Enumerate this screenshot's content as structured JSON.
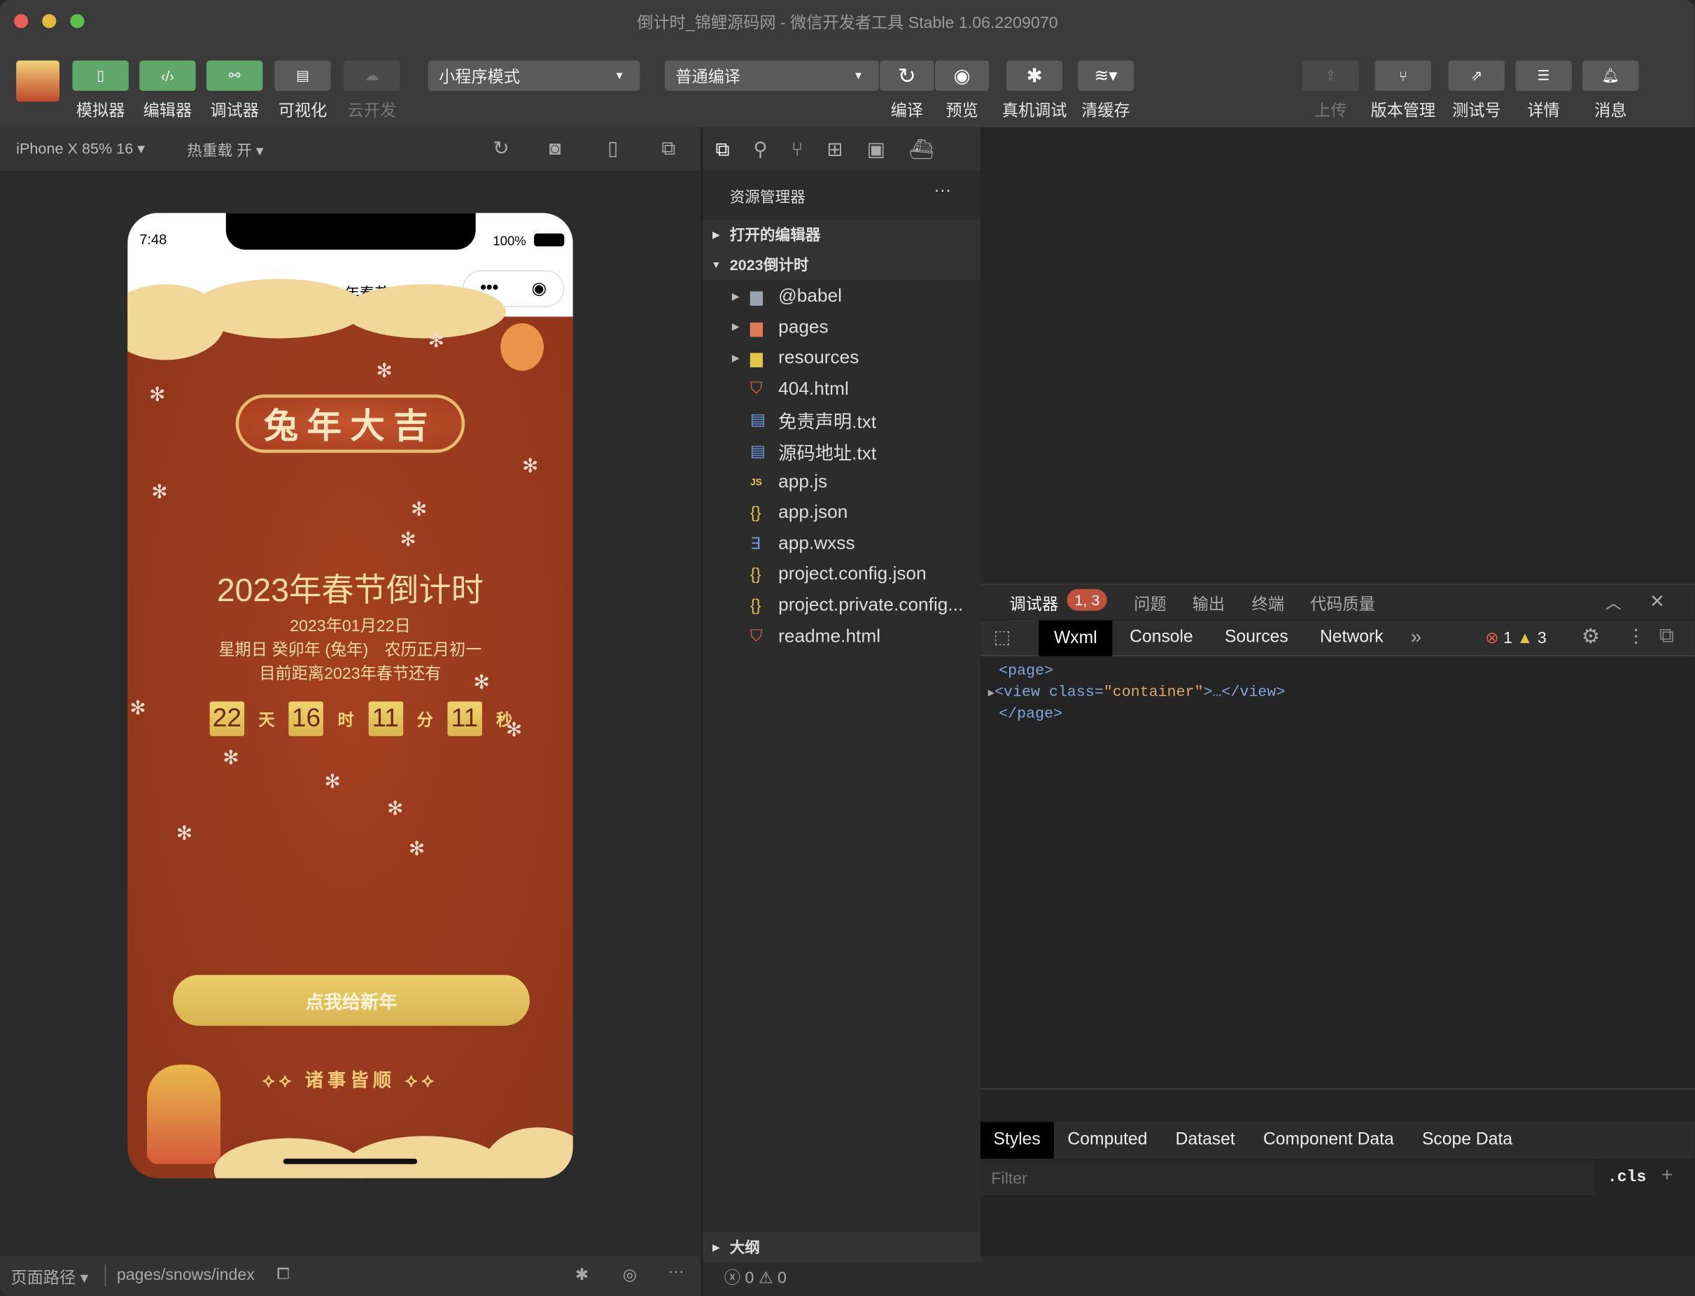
{
  "window": {
    "title": "倒计时_锦鲤源码网 - 微信开发者工具 Stable 1.06.2209070"
  },
  "toolbar": {
    "left": [
      {
        "label": "模拟器",
        "icon": "phone-icon"
      },
      {
        "label": "编辑器",
        "icon": "code-icon"
      },
      {
        "label": "调试器",
        "icon": "debug-icon"
      },
      {
        "label": "可视化",
        "icon": "layout-icon"
      },
      {
        "label": "云开发",
        "icon": "cloud-icon"
      }
    ],
    "mode_select": "小程序模式",
    "compile_select": "普通编译",
    "mid": [
      {
        "label": "编译",
        "icon": "refresh-icon"
      },
      {
        "label": "预览",
        "icon": "eye-icon"
      },
      {
        "label": "真机调试",
        "icon": "bug-icon"
      },
      {
        "label": "清缓存",
        "icon": "layers-icon"
      }
    ],
    "right": [
      {
        "label": "上传",
        "icon": "upload-icon"
      },
      {
        "label": "版本管理",
        "icon": "branch-icon"
      },
      {
        "label": "测试号",
        "icon": "external-icon"
      },
      {
        "label": "详情",
        "icon": "menu-icon"
      },
      {
        "label": "消息",
        "icon": "bell-icon"
      }
    ]
  },
  "simulator": {
    "device": "iPhone X 85% 16",
    "hot_reload": "热重载 开",
    "phone": {
      "time": "7:48",
      "battery": "100%",
      "nav_title": "2023年春节",
      "banner": "兔年大吉",
      "heading": "2023年春节倒计时",
      "date": "2023年01月22日",
      "lunar": "星期日 癸卯年 (兔年)　农历正月初一",
      "remaining": "目前距离2023年春节还有",
      "countdown": [
        {
          "value": "22",
          "unit": "天"
        },
        {
          "value": "16",
          "unit": "时"
        },
        {
          "value": "11",
          "unit": "分"
        },
        {
          "value": "11",
          "unit": "秒"
        }
      ],
      "button": "点我给新年",
      "footer": "诸事皆顺"
    }
  },
  "bottom": {
    "path_label": "页面路径",
    "path": "pages/snows/index"
  },
  "explorer": {
    "title": "资源管理器",
    "open_editors": "打开的编辑器",
    "project": "2023倒计时",
    "files": [
      {
        "name": "@babel",
        "type": "folder",
        "color": "#9aa4b0"
      },
      {
        "name": "pages",
        "type": "folder",
        "color": "#e07a5a"
      },
      {
        "name": "resources",
        "type": "folder",
        "color": "#e6c34a"
      },
      {
        "name": "404.html",
        "type": "html",
        "color": "#e06c4a"
      },
      {
        "name": "免责声明.txt",
        "type": "txt",
        "color": "#6b9be6"
      },
      {
        "name": "源码地址.txt",
        "type": "txt",
        "color": "#6b9be6"
      },
      {
        "name": "app.js",
        "type": "js",
        "color": "#e6c34a"
      },
      {
        "name": "app.json",
        "type": "json",
        "color": "#e6c34a"
      },
      {
        "name": "app.wxss",
        "type": "css",
        "color": "#6b9be6"
      },
      {
        "name": "project.config.json",
        "type": "json",
        "color": "#e6c34a"
      },
      {
        "name": "project.private.config...",
        "type": "json",
        "color": "#e6c34a"
      },
      {
        "name": "readme.html",
        "type": "html",
        "color": "#e06c4a"
      }
    ],
    "outline": "大纲",
    "errors": "0",
    "warnings": "0"
  },
  "devtools": {
    "tabs": [
      "调试器",
      "问题",
      "输出",
      "终端",
      "代码质量"
    ],
    "badge": "1, 3",
    "subtabs": [
      "Wxml",
      "Console",
      "Sources",
      "Network"
    ],
    "error_count": "1",
    "warning_count": "3",
    "wxml": {
      "open": "<page>",
      "tag_open": "<view class=",
      "class_value": "\"container\"",
      "tag_close": ">…</view>",
      "close": "</page>"
    },
    "style_tabs": [
      "Styles",
      "Computed",
      "Dataset",
      "Component Data",
      "Scope Data"
    ],
    "filter_placeholder": "Filter",
    "cls": ".cls"
  },
  "colors": {
    "accent_green": "#5fa86a",
    "phone_red": "#9b3b20",
    "gold": "#e4c15a",
    "badge": "#c0513c"
  }
}
